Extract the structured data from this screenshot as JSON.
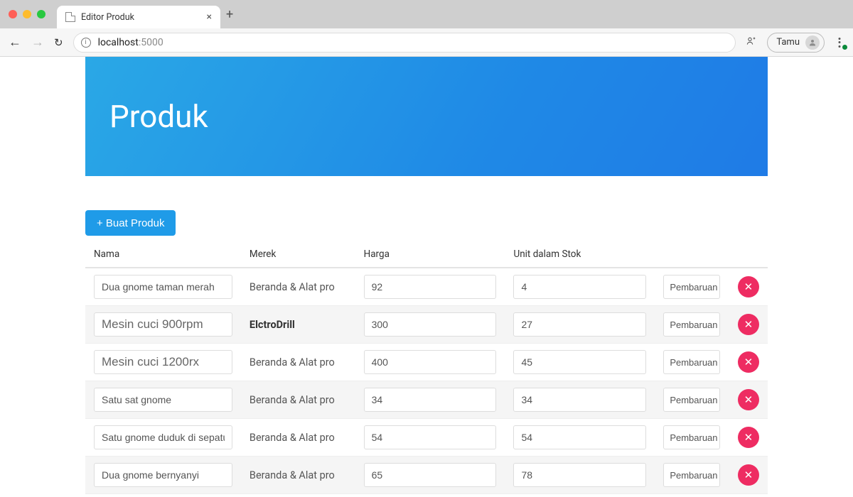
{
  "browser": {
    "tab_title": "Editor Produk",
    "url_host": "localhost",
    "url_port": ":5000",
    "guest_label": "Tamu"
  },
  "hero": {
    "title": "Produk"
  },
  "actions": {
    "create_label": "+ Buat Produk",
    "update_label": "Pembaruan"
  },
  "table": {
    "headers": {
      "name": "Nama",
      "brand": "Merek",
      "price": "Harga",
      "stock": "Unit dalam Stok"
    },
    "rows": [
      {
        "name": "Dua gnome taman merah",
        "brand": "Beranda & Alat pro",
        "brand_bold": false,
        "price": "92",
        "stock": "4",
        "input_size": "small"
      },
      {
        "name": "Mesin cuci 900rpm",
        "brand": "ElctroDrill",
        "brand_bold": true,
        "price": "300",
        "stock": "27",
        "input_size": "big"
      },
      {
        "name": "Mesin cuci 1200rx",
        "brand": "Beranda & Alat pro",
        "brand_bold": false,
        "price": "400",
        "stock": "45",
        "input_size": "big"
      },
      {
        "name": "Satu sat gnome",
        "brand": "Beranda & Alat pro",
        "brand_bold": false,
        "price": "34",
        "stock": "34",
        "input_size": "small"
      },
      {
        "name": "Satu gnome duduk di sepatu",
        "brand": "Beranda & Alat pro",
        "brand_bold": false,
        "price": "54",
        "stock": "54",
        "input_size": "small"
      },
      {
        "name": "Dua gnome bernyanyi",
        "brand": "Beranda & Alat pro",
        "brand_bold": false,
        "price": "65",
        "stock": "78",
        "input_size": "small"
      }
    ]
  }
}
